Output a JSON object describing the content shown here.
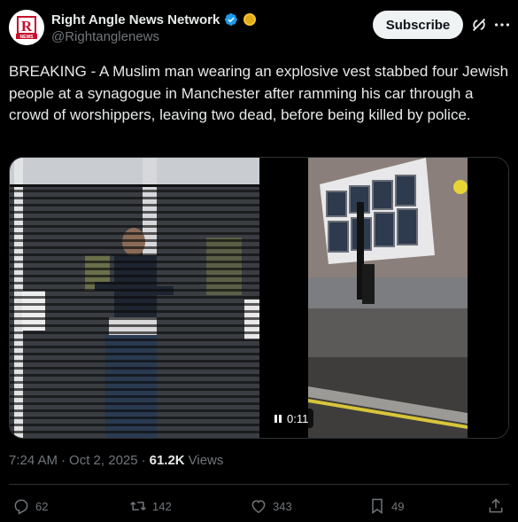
{
  "author": {
    "display_name": "Right Angle News Network",
    "handle": "@Rightanglenews",
    "avatar_text": "R"
  },
  "header": {
    "subscribe_label": "Subscribe"
  },
  "post": {
    "text": "BREAKING - A Muslim man wearing an explosive vest stabbed four Jewish people at a synagogue in Manchester after ramming his car through a crowd of worshippers, leaving two dead, before being killed by police."
  },
  "video": {
    "time": "0:11"
  },
  "meta": {
    "time": "7:24 AM",
    "separator": "·",
    "date": "Oct 2, 2025",
    "separator2": "·",
    "views_count": "61.2K",
    "views_label": "Views"
  },
  "actions": {
    "replies": "62",
    "reposts": "142",
    "likes": "343",
    "bookmarks": "49"
  },
  "colors": {
    "background": "#000000",
    "text": "#e7e9ea",
    "muted": "#71767b",
    "verified": "#1d9bf0",
    "brand_red": "#c8102e"
  },
  "icons": [
    "verified-badge-icon",
    "gold-badge-icon",
    "grok-icon",
    "more-icon",
    "pause-icon",
    "reply-icon",
    "repost-icon",
    "like-icon",
    "bookmark-icon",
    "share-icon"
  ]
}
